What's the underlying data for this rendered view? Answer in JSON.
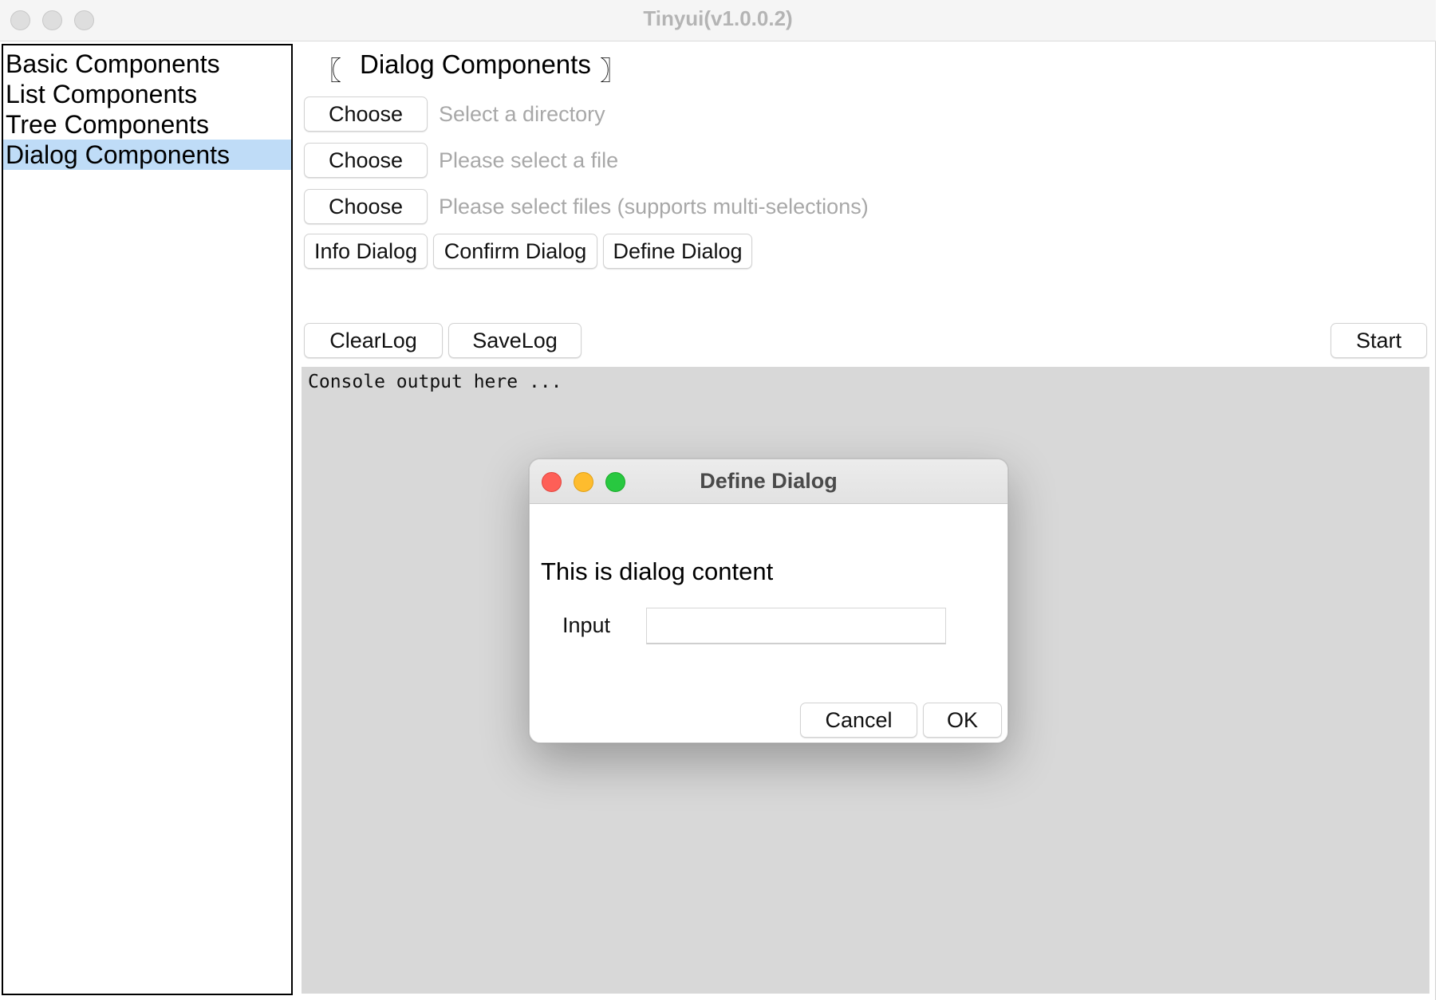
{
  "window": {
    "title": "Tinyui(v1.0.0.2)"
  },
  "sidebar": {
    "items": [
      {
        "label": "Basic Components"
      },
      {
        "label": "List Components"
      },
      {
        "label": "Tree Components"
      },
      {
        "label": "Dialog Components",
        "selected": true
      }
    ]
  },
  "main": {
    "section_title": "Dialog Components",
    "bracket_left": "〖",
    "bracket_right": "〗",
    "choose_rows": [
      {
        "button": "Choose",
        "placeholder": "Select a directory"
      },
      {
        "button": "Choose",
        "placeholder": "Please select a file"
      },
      {
        "button": "Choose",
        "placeholder": "Please select files (supports multi-selections)"
      }
    ],
    "dialog_buttons": {
      "info": "Info Dialog",
      "confirm": "Confirm Dialog",
      "define": "Define Dialog"
    },
    "log_buttons": {
      "clear": "ClearLog",
      "save": "SaveLog",
      "start": "Start"
    },
    "console": {
      "text": "Console output here ..."
    }
  },
  "dialog": {
    "title": "Define Dialog",
    "content": "This is dialog content",
    "input_label": "Input",
    "input_value": "",
    "cancel": "Cancel",
    "ok": "OK"
  },
  "colors": {
    "selection": "#bfdcf7",
    "console_bg": "#d8d8d8",
    "close": "#fe5f57",
    "minimize": "#febc2e",
    "zoom": "#28c840",
    "placeholder": "#a8a8a8"
  }
}
